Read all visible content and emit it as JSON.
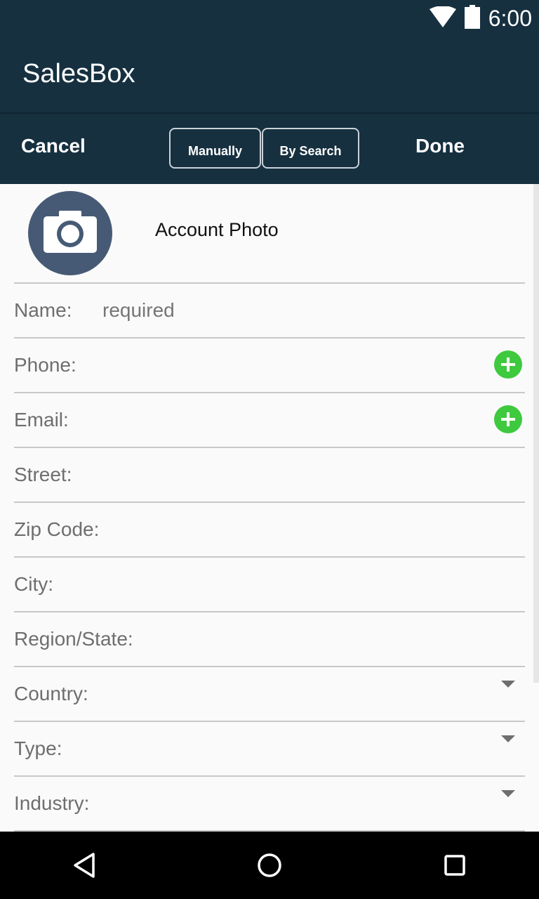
{
  "status": {
    "time": "6:00",
    "icons": [
      "wifi-icon",
      "battery-icon"
    ]
  },
  "app": {
    "title": "SalesBox"
  },
  "toolbar": {
    "cancel_label": "Cancel",
    "done_label": "Done",
    "segments": [
      "Manually",
      "By Search"
    ]
  },
  "form": {
    "photo_label": "Account Photo",
    "fields": {
      "name": {
        "label": "Name:",
        "placeholder": "required"
      },
      "phone": {
        "label": "Phone:"
      },
      "email": {
        "label": "Email:"
      },
      "street": {
        "label": "Street:"
      },
      "zip": {
        "label": "Zip Code:"
      },
      "city": {
        "label": "City:"
      },
      "region": {
        "label": "Region/State:"
      },
      "country": {
        "label": "Country:"
      },
      "type": {
        "label": "Type:"
      },
      "industry": {
        "label": "Industry:"
      }
    }
  },
  "colors": {
    "header": "#163040",
    "avatar": "#475a75",
    "add": "#3ec93e"
  }
}
